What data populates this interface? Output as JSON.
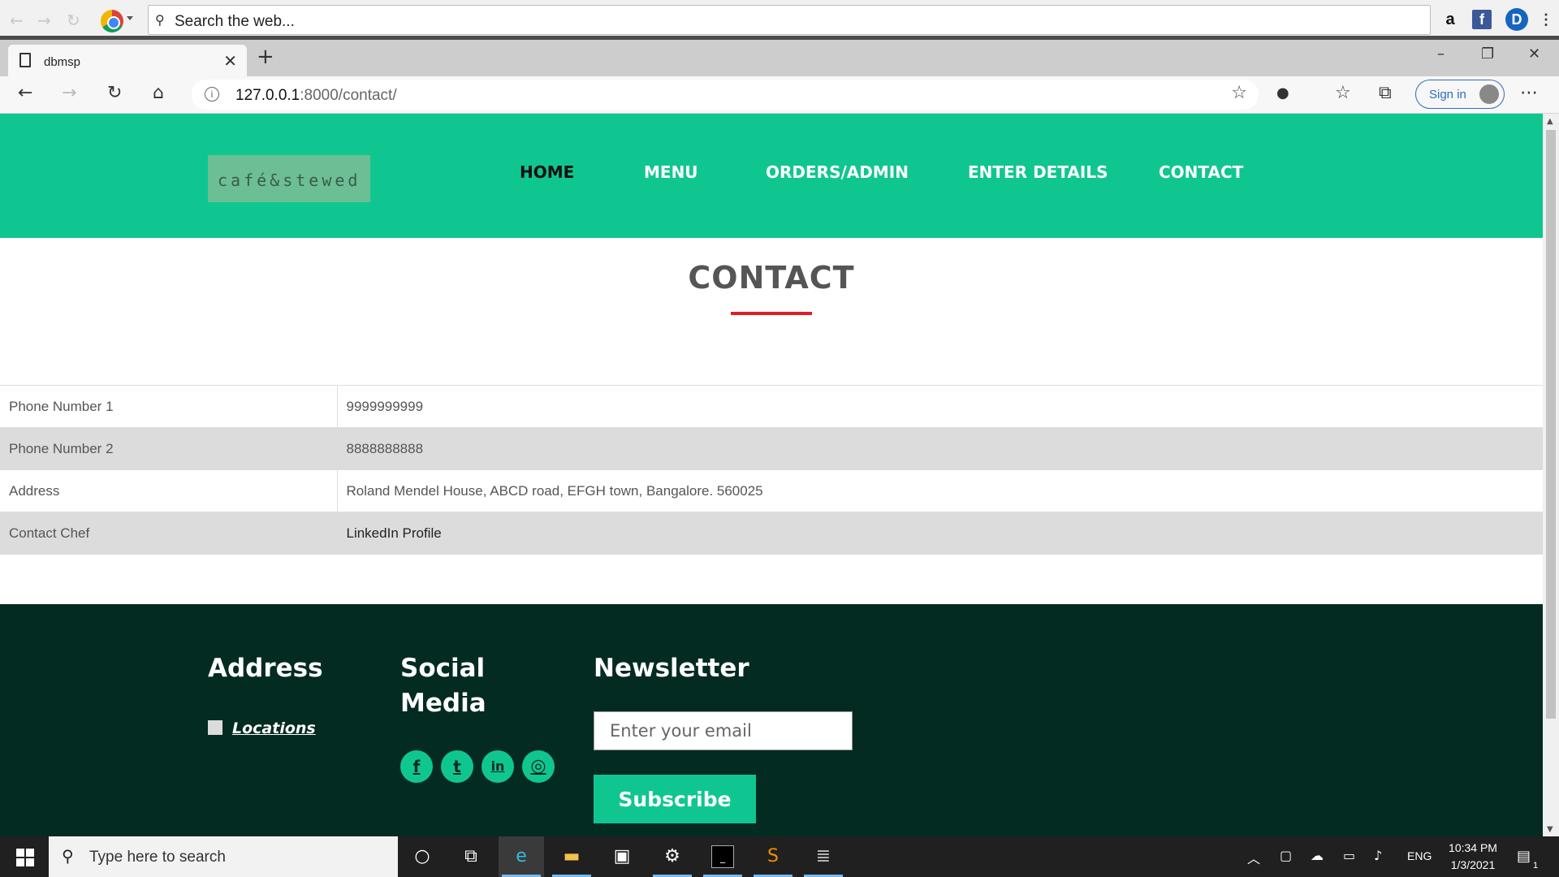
{
  "outer_toolbar": {
    "search_placeholder": "Search the web..."
  },
  "browser": {
    "tab_title": "dbmsp",
    "url_host": "127.0.0.1",
    "url_rest": ":8000/contact/",
    "signin_label": "Sign in"
  },
  "site": {
    "logo_text": "café&stewed",
    "nav": [
      "HOME",
      "MENU",
      "ORDERS/ADMIN",
      "ENTER DETAILS",
      "CONTACT"
    ],
    "active_nav": "HOME"
  },
  "contact": {
    "title": "CONTACT",
    "rows": [
      {
        "label": "Phone Number 1",
        "value": "9999999999"
      },
      {
        "label": "Phone Number 2",
        "value": "8888888888"
      },
      {
        "label": "Address",
        "value": "Roland Mendel House, ABCD road, EFGH town, Bangalore. 560025"
      },
      {
        "label": "Contact Chef",
        "value": "LinkedIn Profile"
      }
    ]
  },
  "footer": {
    "address_heading": "Address",
    "locations_label": "Locations",
    "social_heading_line1": "Social",
    "social_heading_line2": "Media",
    "social_icons": [
      "facebook-icon",
      "twitter-icon",
      "linkedin-icon",
      "instagram-icon"
    ],
    "newsletter_heading": "Newsletter",
    "email_placeholder": "Enter your email",
    "subscribe_label": "Subscribe"
  },
  "taskbar": {
    "search_placeholder": "Type here to search",
    "language": "ENG",
    "time": "10:34 PM",
    "date": "1/3/2021",
    "notification_count": "1"
  },
  "colors": {
    "brand_green": "#10c690",
    "footer_bg": "#032b22",
    "title_rule": "#e31c24"
  }
}
